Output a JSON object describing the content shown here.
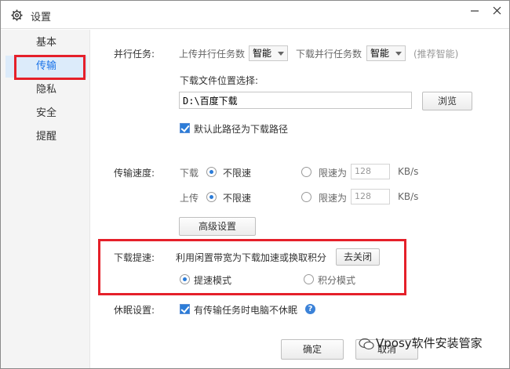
{
  "window": {
    "title": "设置"
  },
  "sidebar": {
    "items": [
      {
        "label": "基本"
      },
      {
        "label": "传输"
      },
      {
        "label": "隐私"
      },
      {
        "label": "安全"
      },
      {
        "label": "提醒"
      }
    ],
    "active": "传输"
  },
  "parallel": {
    "section_label": "并行任务:",
    "upload_label": "上传并行任务数",
    "upload_value": "智能",
    "download_label": "下载并行任务数",
    "download_value": "智能",
    "hint": "(推荐智能)"
  },
  "download_location": {
    "label": "下载文件位置选择:",
    "path": "D:\\百度下载",
    "browse_label": "浏览",
    "default_checkbox_label": "默认此路径为下载路径",
    "default_checked": true
  },
  "speed": {
    "section_label": "传输速度:",
    "download_label": "下载",
    "upload_label": "上传",
    "unlimited_label": "不限速",
    "limit_label": "限速为",
    "download_limit_value": "128",
    "upload_limit_value": "128",
    "unit": "KB/s",
    "advanced_label": "高级设置"
  },
  "accelerate": {
    "section_label": "下载提速:",
    "description": "利用闲置带宽为下载加速或换取积分",
    "close_label": "去关闭",
    "mode_speed_label": "提速模式",
    "mode_points_label": "积分模式",
    "selected_mode": "提速模式"
  },
  "sleep": {
    "section_label": "休眠设置:",
    "checkbox_label": "有传输任务时电脑不休眠",
    "checked": true
  },
  "footer": {
    "ok_label": "确定",
    "cancel_label": "取消"
  },
  "watermark": {
    "text": "Vposy软件安装管家"
  },
  "colors": {
    "accent": "#2b7cd8",
    "highlight_border": "#e5202a",
    "sidebar_active_bg": "#dcebfa"
  }
}
